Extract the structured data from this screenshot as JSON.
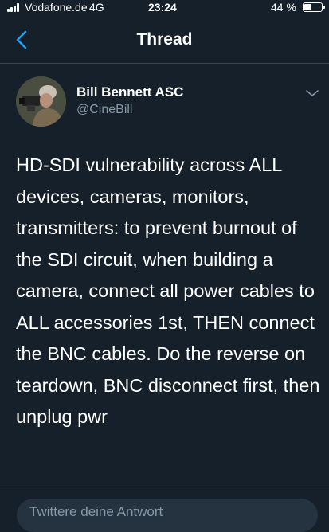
{
  "status_bar": {
    "carrier": "Vodafone.de",
    "network": "4G",
    "time": "23:24",
    "battery_percent_label": "44 %",
    "battery_level": 0.44
  },
  "header": {
    "title": "Thread",
    "back_icon": "chevron-left-icon"
  },
  "tweet": {
    "author_name": "Bill Bennett ASC",
    "author_handle": "@CineBill",
    "text": "HD-SDI vulnerability across ALL devices, cameras, monitors, transmitters: to prevent burnout of the SDI circuit, when building a camera, connect all power cables to ALL accessories 1st, THEN connect the BNC cables. Do the reverse on teardown, BNC disconnect first, then unplug pwr",
    "menu_icon": "chevron-down-icon"
  },
  "reply": {
    "placeholder": "Twittere deine Antwort"
  },
  "colors": {
    "background": "#15202b",
    "accent": "#1da1f2",
    "secondary_text": "#8899a6",
    "divider": "#38444d"
  }
}
